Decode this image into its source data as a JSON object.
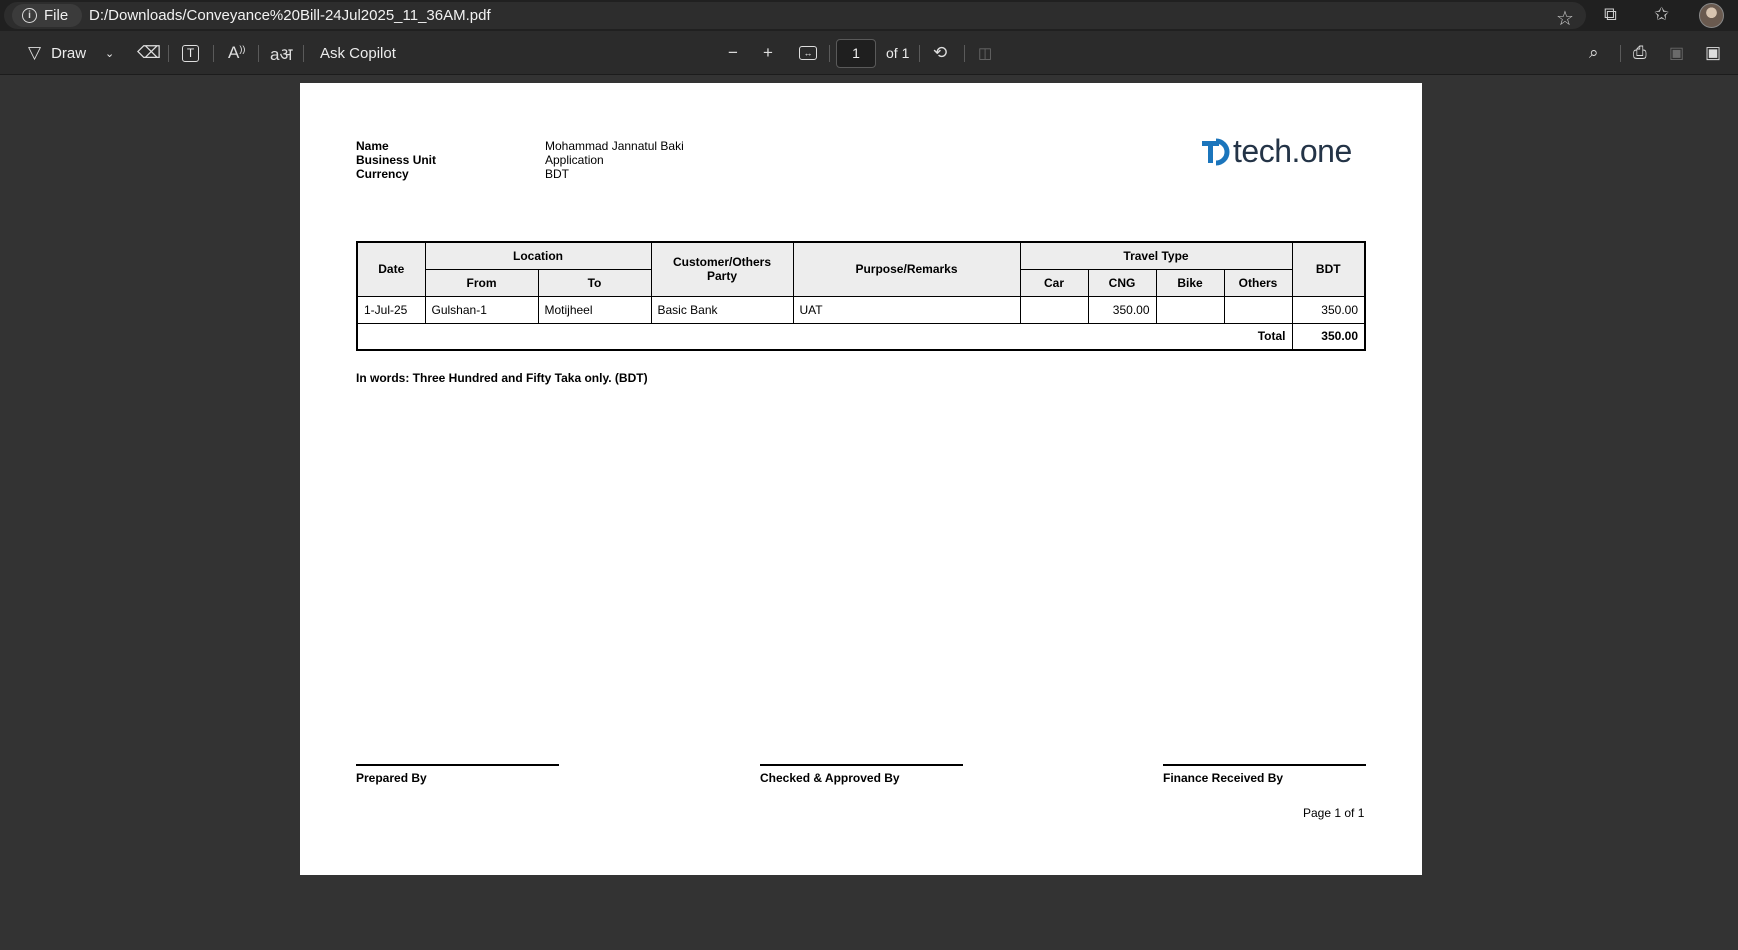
{
  "browser": {
    "file_chip": "File",
    "url": "D:/Downloads/Conveyance%20Bill-24Jul2025_11_36AM.pdf"
  },
  "toolbar": {
    "draw": "Draw",
    "ask_copilot": "Ask Copilot",
    "page_current": "1",
    "page_total": "of 1"
  },
  "doc": {
    "header": [
      {
        "label": "Name",
        "value": "Mohammad Jannatul Baki"
      },
      {
        "label": "Business Unit",
        "value": "Application"
      },
      {
        "label": "Currency",
        "value": "BDT"
      }
    ],
    "logo_text": "tech.one",
    "columns": {
      "date": "Date",
      "location": "Location",
      "from": "From",
      "to": "To",
      "customer": "Customer/Others Party",
      "purpose": "Purpose/Remarks",
      "travel_type": "Travel Type",
      "car": "Car",
      "cng": "CNG",
      "bike": "Bike",
      "others": "Others",
      "bdt": "BDT"
    },
    "rows": [
      {
        "date": "1-Jul-25",
        "from": "Gulshan-1",
        "to": "Motijheel",
        "customer": "Basic Bank",
        "purpose": "UAT",
        "car": "",
        "cng": "350.00",
        "bike": "",
        "others": "",
        "bdt": "350.00"
      }
    ],
    "total_label": "Total",
    "total_value": "350.00",
    "in_words": "In words: Three Hundred and Fifty Taka only. (BDT)",
    "signatures": {
      "prepared": "Prepared By",
      "checked": "Checked & Approved By",
      "finance": "Finance Received By"
    },
    "page_number": "Page 1 of 1"
  }
}
